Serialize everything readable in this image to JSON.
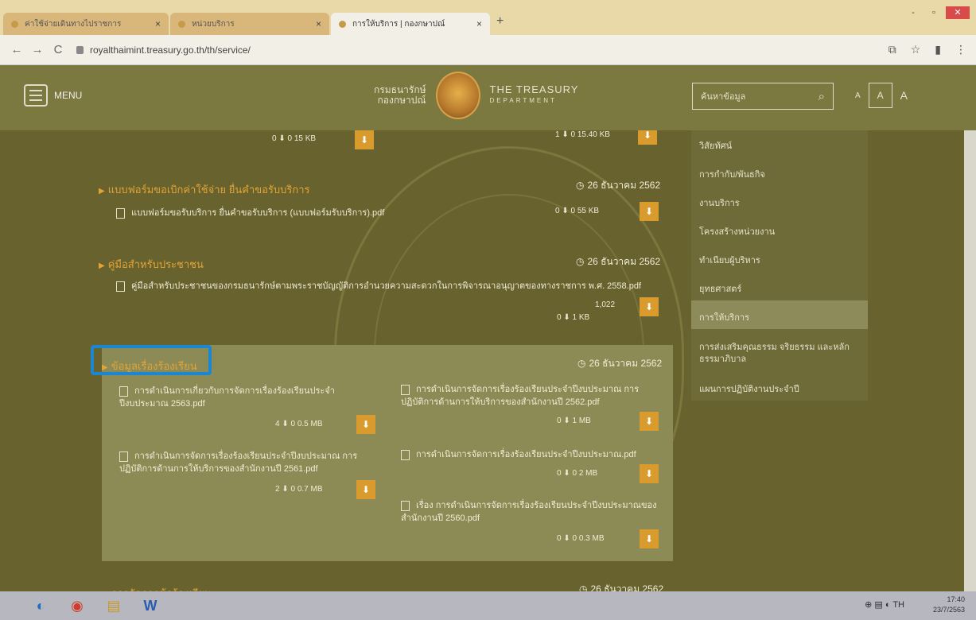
{
  "browser": {
    "tabs": [
      {
        "label": "ค่าใช้จ่ายเดินทางไปราชการ"
      },
      {
        "label": "หน่วยบริการ"
      },
      {
        "label": "การให้บริการ | กองกษาปณ์"
      }
    ],
    "new_tab": "+",
    "url": "royalthaimint.treasury.go.th/th/service/",
    "nav": {
      "back": "←",
      "forward": "→",
      "reload": "C"
    },
    "win_controls": {
      "min": "-",
      "max": "▫",
      "close": "✕"
    },
    "addr_icons": {
      "translate": "⧉",
      "star": "☆",
      "ext": "▮",
      "more": "⋮"
    }
  },
  "header": {
    "menu_label": "MENU",
    "org_th_line1": "กรมธนารักษ์",
    "org_th_line2": "กองกษาปณ์",
    "org_en_line1": "THE TREASURY",
    "org_en_line2": "DEPARTMENT",
    "search_placeholder": "ค้นหาข้อมูล",
    "search_icon": "⌕",
    "font_small": "A",
    "font_mid": "A",
    "font_large": "A"
  },
  "content": {
    "top_row": {
      "meta_left": "0 ⬇ 0 15 KB",
      "meta_right": "1 ⬇ 0 15.40 KB"
    },
    "sec1": {
      "title": "แบบฟอร์มขอเบิกค่าใช้จ่าย ยื่นคำขอรับบริการ",
      "date": "26 ธันวาคม 2562",
      "file": "แบบฟอร์มขอรับบริการ ยื่นคำขอรับบริการ (แบบฟอร์มรับบริการ).pdf",
      "meta": "0 ⬇ 0 55 KB"
    },
    "sec2": {
      "title": "คู่มือสำหรับประชาชน",
      "date": "26 ธันวาคม 2562",
      "file": "คู่มือสำหรับประชาชนของกรมธนารักษ์ตามพระราชบัญญัติการอำนวยความสะดวกในการพิจารณาอนุญาตของทางราชการ พ.ศ. 2558.pdf",
      "meta1": "1,022",
      "meta2": "0 ⬇ 1 KB"
    },
    "sec3": {
      "title": "ข้อมูลเรื่องร้องเรียน",
      "date": "26 ธันวาคม 2562",
      "files": [
        {
          "label": "การดำเนินการเกี่ยวกับการจัดการเรื่องร้องเรียนประจำปีงบประมาณ 2563.pdf",
          "meta": "4 ⬇ 0 0.5 MB"
        },
        {
          "label": "การดำเนินการจัดการเรื่องร้องเรียนประจำปีงบประมาณ การปฏิบัติการด้านการให้บริการของสำนักงานปี 2562.pdf",
          "meta": "0 ⬇ 1 MB"
        },
        {
          "label": "การดำเนินการจัดการเรื่องร้องเรียนประจำปีงบประมาณ การปฏิบัติการด้านการให้บริการของสำนักงานปี 2561.pdf",
          "meta": "2 ⬇ 0 0.7 MB"
        },
        {
          "label": "การดำเนินการจัดการเรื่องร้องเรียนประจำปีงบประมาณ.pdf",
          "meta": "0 ⬇ 0 2 MB"
        },
        {
          "label": "เรื่อง การดำเนินการจัดการเรื่องร้องเรียนประจำปีงบประมาณของสำนักงานปี 2560.pdf",
          "meta": "0 ⬇ 0 0.3 MB"
        }
      ]
    },
    "sec4": {
      "title": "การจัดการข้อร้องเรียน",
      "date": "26 ธันวาคม 2562"
    },
    "dl_icon": "⬇"
  },
  "dropdown": {
    "items": [
      "วิสัยทัศน์",
      "การกำกับ/พันธกิจ",
      "งานบริการ",
      "โครงสร้างหน่วยงาน",
      "ทำเนียบผู้บริหาร",
      "ยุทธศาสตร์",
      "การให้บริการ",
      "การส่งเสริมคุณธรรม จริยธรรม และหลักธรรมาภิบาล",
      "แผนการปฏิบัติงานประจำปี"
    ]
  },
  "taskbar": {
    "icons": [
      "◐",
      "◉",
      "▤",
      "W"
    ],
    "tray": "⊕ ▤ ◐ TH",
    "time": "17:40",
    "date": "23/7/2563"
  }
}
